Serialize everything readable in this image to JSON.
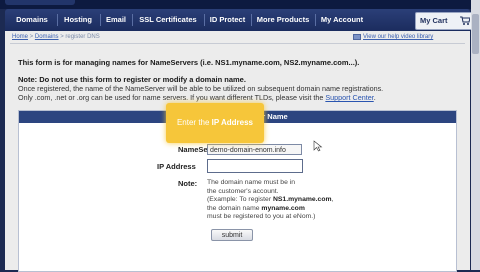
{
  "nav": {
    "items": [
      "Domains",
      "Hosting",
      "Email",
      "SSL Certificates",
      "ID Protect",
      "More Products",
      "My Account"
    ],
    "cart_label": "My Cart"
  },
  "breadcrumb": {
    "home": "Home",
    "domains": "Domains",
    "current": "register DNS",
    "sep1": " > ",
    "sep2": " > "
  },
  "video_link": "View our help video library",
  "intro": "This form is for managing names for NameServers (i.e. NS1.myname.com, NS2.myname.com...).",
  "note": {
    "title": "Note: Do not use this form to register or modify a domain name.",
    "line1": "Once registered, the name of the NameServer will be able to be utilized on subsequent domain name registrations.",
    "line2": "Only .com, .net or .org can be used for name servers. If you want different TLDs, please visit the",
    "link": "Support Center",
    "end": "."
  },
  "form": {
    "header": "Register Name Server Name",
    "nameserver_label": "NameServer:",
    "nameserver_value": "demo-domain-enom.info",
    "ip_label": "IP Address",
    "ip_value": "",
    "note_label": "Note:",
    "help": {
      "l1": "The domain name must be in",
      "l2": "the customer's account.",
      "l3a": "(Example: To register ",
      "l3b": "NS1.myname.com",
      "l3c": ",",
      "l4a": "the domain name ",
      "l4b": "myname.com",
      "l5": "must be registered to you at eNom.)"
    },
    "submit_label": "submit"
  },
  "tooltip": {
    "text": "Enter the ",
    "bold": "IP Address"
  },
  "colors": {
    "nav_bg": "#1b2c5e",
    "form_header": "#2c4580",
    "tooltip": "#f6c63a",
    "link": "#2a55b0"
  }
}
